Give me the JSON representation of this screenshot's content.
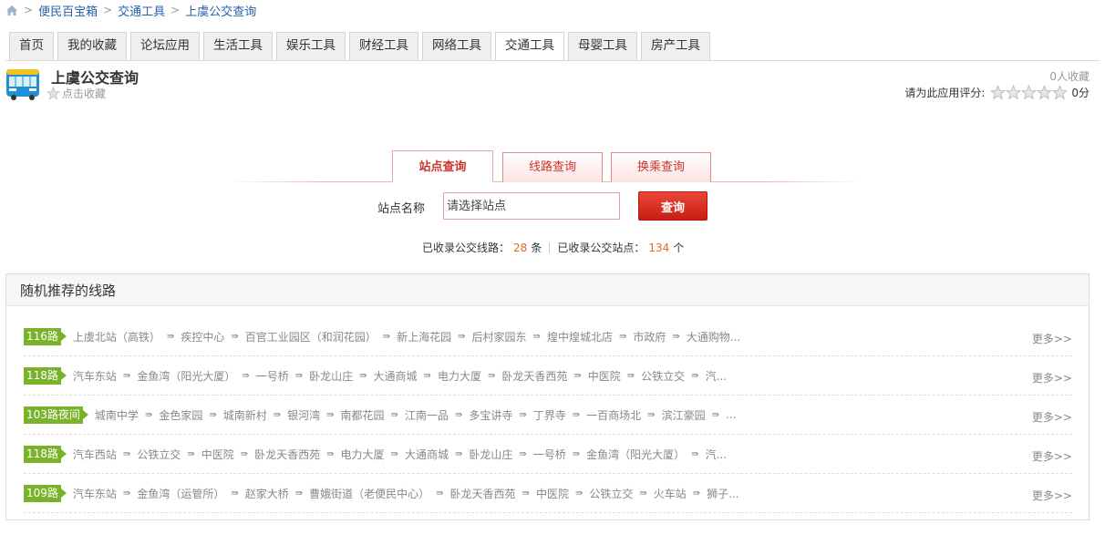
{
  "breadcrumb": {
    "items": [
      "便民百宝箱",
      "交通工具",
      "上虞公交查询"
    ]
  },
  "tabs": [
    "首页",
    "我的收藏",
    "论坛应用",
    "生活工具",
    "娱乐工具",
    "财经工具",
    "网络工具",
    "交通工具",
    "母婴工具",
    "房产工具"
  ],
  "active_tab": "交通工具",
  "app": {
    "title": "上虞公交查询",
    "favorite_label": "点击收藏",
    "favorite_count": "0人收藏",
    "rating_label": "请为此应用评分:",
    "rating_score": "0分",
    "rating_stars": 0
  },
  "query": {
    "tabs": [
      "站点查询",
      "线路查询",
      "换乘查询"
    ],
    "active": "站点查询",
    "field_label": "站点名称",
    "placeholder": "请选择站点",
    "button": "查询"
  },
  "stats": {
    "lines_prefix": "已收录公交线路：",
    "lines_count": "28",
    "lines_unit": "条",
    "stations_prefix": "已收录公交站点：",
    "stations_count": "134",
    "stations_unit": "个"
  },
  "recommend": {
    "title": "随机推荐的线路",
    "more_label": "更多>>",
    "arrow": "⇛",
    "routes": [
      {
        "name": "116路",
        "stops": [
          "上虞北站（高铁）",
          "疾控中心",
          "百官工业园区（和润花园）",
          "新上海花园",
          "后村家园东",
          "煌中煌城北店",
          "市政府",
          "大通购物..."
        ]
      },
      {
        "name": "118路",
        "stops": [
          "汽车东站",
          "金鱼湾（阳光大厦）",
          "一号桥",
          "卧龙山庄",
          "大通商城",
          "电力大厦",
          "卧龙天香西苑",
          "中医院",
          "公铁立交",
          "汽..."
        ]
      },
      {
        "name": "103路夜间",
        "stops": [
          "城南中学",
          "金色家园",
          "城南新村",
          "银河湾",
          "南都花园",
          "江南一品",
          "多宝讲寺",
          "丁界寺",
          "一百商场北",
          "滨江豪园",
          "..."
        ]
      },
      {
        "name": "118路",
        "stops": [
          "汽车西站",
          "公铁立交",
          "中医院",
          "卧龙天香西苑",
          "电力大厦",
          "大通商城",
          "卧龙山庄",
          "一号桥",
          "金鱼湾（阳光大厦）",
          "汽..."
        ]
      },
      {
        "name": "109路",
        "stops": [
          "汽车东站",
          "金鱼湾（运管所）",
          "赵家大桥",
          "曹娥街道（老便民中心）",
          "卧龙天香西苑",
          "中医院",
          "公铁立交",
          "火车站",
          "狮子..."
        ]
      }
    ]
  },
  "colors": {
    "accent_red": "#c8372d",
    "route_green": "#7ab229",
    "link_blue": "#2a5ea8",
    "count_orange": "#e46b1c"
  }
}
